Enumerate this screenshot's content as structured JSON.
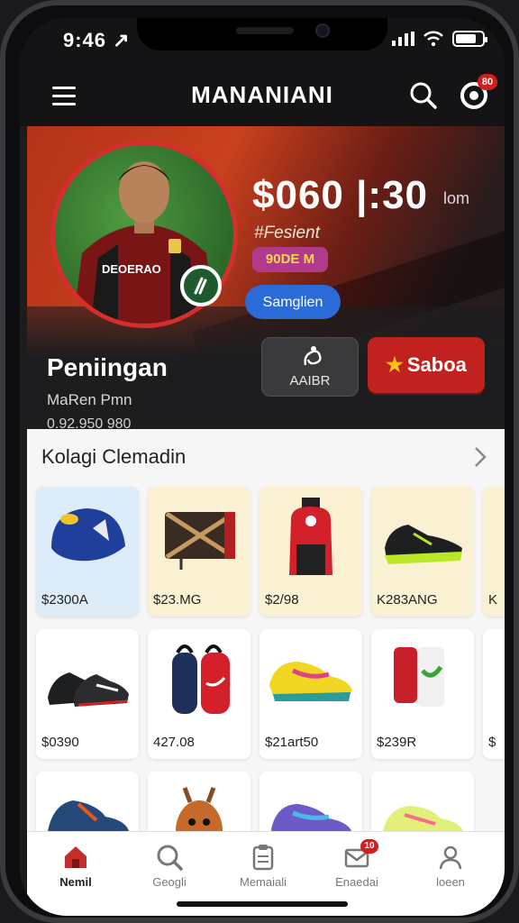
{
  "status": {
    "time": "9:46 ↗"
  },
  "header": {
    "title": "MANANIANI",
    "notif_count": "80"
  },
  "hero": {
    "price": "$060 |:30",
    "price_unit": "lom",
    "hashtag": "#Fesient",
    "tag": "90DE M",
    "blue_button": "Samglien",
    "name": "Peniingan",
    "subname": "MaRen Pmn",
    "subnum": "0.92.950 980",
    "dark_button": "AAIBR",
    "red_button": "Saboa",
    "jersey_text": "DEOERAO"
  },
  "section": {
    "title": "Kolagi Clemadin",
    "cards": [
      {
        "price": "$2300A",
        "bg": "#dcecf8",
        "item": "cap"
      },
      {
        "price": "$23.MG",
        "bg": "#faf0d2",
        "item": "bag"
      },
      {
        "price": "$2/98",
        "bg": "#faf0d2",
        "item": "backpack"
      },
      {
        "price": "K283ANG",
        "bg": "#faf0d2",
        "item": "shoe-green"
      },
      {
        "price": "K",
        "bg": "#faf0d2",
        "item": "partial"
      },
      {
        "price": "$0390",
        "bg": "#ffffff",
        "item": "shoe-black"
      },
      {
        "price": "427.08",
        "bg": "#ffffff",
        "item": "bottles"
      },
      {
        "price": "$21art50",
        "bg": "#ffffff",
        "item": "shoe-color"
      },
      {
        "price": "$239R",
        "bg": "#ffffff",
        "item": "socks"
      },
      {
        "price": "$",
        "bg": "#ffffff",
        "item": "partial"
      }
    ]
  },
  "tabs": [
    {
      "label": "Nemil",
      "icon": "home-icon"
    },
    {
      "label": "Geogli",
      "icon": "search-icon"
    },
    {
      "label": "Memaiali",
      "icon": "clipboard-icon"
    },
    {
      "label": "Enaedai",
      "icon": "inbox-icon",
      "badge": "10"
    },
    {
      "label": "loeen",
      "icon": "profile-icon"
    }
  ],
  "colors": {
    "accent_red": "#c2221f",
    "accent_blue": "#2a6bd8",
    "header_bg": "#141416"
  }
}
